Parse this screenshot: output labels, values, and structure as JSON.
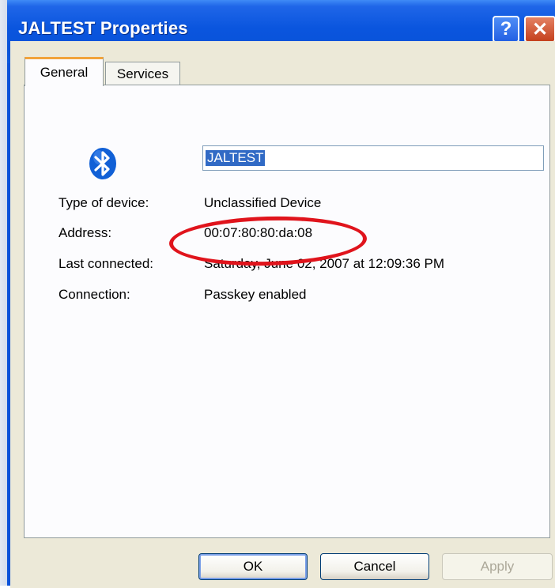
{
  "window": {
    "title": "JALTEST Properties",
    "help_glyph": "?",
    "close_glyph": "✕",
    "accent_color": "#0a55de"
  },
  "tabs": [
    {
      "label": "General",
      "selected": true
    },
    {
      "label": "Services",
      "selected": false
    }
  ],
  "device": {
    "icon": "bluetooth-icon",
    "name": "JALTEST",
    "rows": [
      {
        "label": "Type of device:",
        "value": "Unclassified Device"
      },
      {
        "label": "Address:",
        "value": "00:07:80:80:da:08"
      },
      {
        "label": "Last connected:",
        "value": "Saturday, June 02, 2007 at 12:09:36 PM"
      },
      {
        "label": "Connection:",
        "value": "Passkey enabled"
      }
    ]
  },
  "annotation": {
    "shape": "ellipse",
    "color": "#e0141c",
    "highlights": "Address"
  },
  "buttons": {
    "ok": "OK",
    "cancel": "Cancel",
    "apply": "Apply",
    "apply_enabled": false
  }
}
